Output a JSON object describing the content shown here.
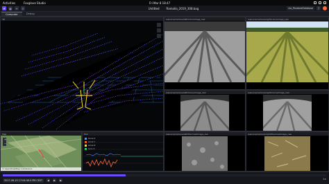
{
  "os": {
    "activities": "Activities",
    "app_name": "Foxglove Studio",
    "clock": "Fri Mar 8  18:47",
    "tray": [
      "network-icon",
      "volume-icon",
      "power-icon"
    ]
  },
  "toolbar": {
    "file_name": "Ramalla_2019_308.bag",
    "layout_label": "Untitled",
    "right_pill": "via_PandoraDatabase",
    "icons": [
      "foxglove-logo-icon",
      "layout-icon",
      "add-panel-icon",
      "variables-icon"
    ]
  },
  "tabs": [
    "Computer",
    "Debug"
  ],
  "panels": {
    "three_d": {
      "title": "3D"
    },
    "cam1": {
      "title": "/sensors/camera/left/color/image_raw"
    },
    "cam2": {
      "title": "/sensors/camera/right/color/image_raw"
    },
    "cam3": {
      "title": "/sensors/camera/left/mono/image_raw"
    },
    "cam4": {
      "title": "/sensors/camera/right/mono/image_raw"
    },
    "cam5": {
      "title": "/sensors/camera/left/thermal/image_raw"
    },
    "cam6": {
      "title": "/sensors/camera/right/thermal/image_raw"
    },
    "map": {
      "title": "Map",
      "footer": "© OpenStreetMap contributors"
    },
    "plot": {
      "title": "Plot",
      "series": [
        "Accel X",
        "Accel Y",
        "Accel Z",
        "Gyro X"
      ]
    }
  },
  "timeline": {
    "current_time": "2017-06-15 17:04:49.5 PM CEST",
    "speed": "1×",
    "progress": 0.38
  },
  "colors": {
    "accent": "#6b4cff"
  }
}
